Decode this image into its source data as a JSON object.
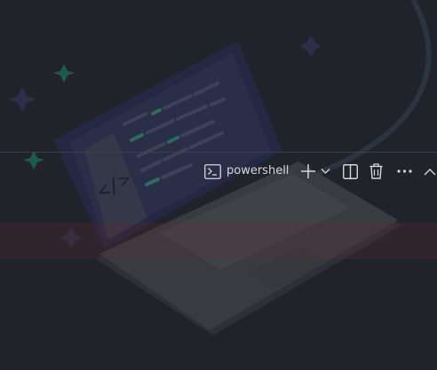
{
  "terminal": {
    "tab_label": "powershell",
    "tab_icon": "terminal-icon"
  },
  "toolbar": {
    "buttons": [
      {
        "icon": "plus-icon",
        "name": "new-terminal"
      },
      {
        "icon": "chevron-down-icon",
        "name": "launch-profile"
      },
      {
        "icon": "split-icon",
        "name": "split-terminal"
      },
      {
        "icon": "trash-icon",
        "name": "kill-terminal"
      },
      {
        "icon": "ellipsis-icon",
        "name": "more-actions"
      },
      {
        "icon": "chevron-up-icon",
        "name": "maximize-panel"
      }
    ]
  },
  "colors": {
    "background": "#20232a",
    "icon": "#d5d8dd",
    "accent_green": "#2ea37a",
    "divider": "#3a3f48"
  }
}
